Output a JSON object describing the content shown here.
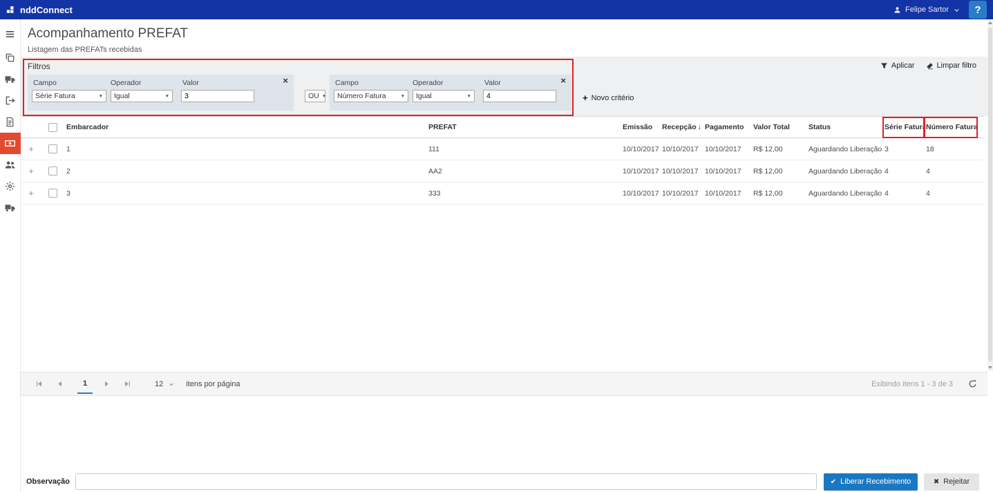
{
  "topbar": {
    "brand": "nddConnect",
    "user_name": "Felipe Sartor",
    "help_label": "?"
  },
  "page": {
    "title": "Acompanhamento PREFAT",
    "subtitle": "Listagem das PREFATs recebidas"
  },
  "filters": {
    "panel_title": "Filtros",
    "apply_label": "Aplicar",
    "clear_label": "Limpar filtro",
    "new_criterion_label": "Novo critério",
    "field_label": "Campo",
    "operator_label": "Operador",
    "value_label": "Valor",
    "connector_value": "OU",
    "criteria": [
      {
        "field": "Série Fatura",
        "operator": "Igual",
        "value": "3"
      },
      {
        "field": "Número Fatura",
        "operator": "Igual",
        "value": "4"
      }
    ]
  },
  "grid": {
    "columns": {
      "embarcador": "Embarcador",
      "prefat": "PREFAT",
      "emissao": "Emissão",
      "recepcao": "Recepção",
      "pagamento": "Pagamento",
      "valor_total": "Valor Total",
      "status": "Status",
      "serie_fatura": "Série Fatura",
      "numero_fatura": "Número Fatura"
    },
    "sorted_column": "Recepção",
    "sort_direction": "desc",
    "rows": [
      {
        "embarcador": "1",
        "prefat": "111",
        "emissao": "10/10/2017",
        "recepcao": "10/10/2017",
        "pagamento": "10/10/2017",
        "valor_total": "R$ 12,00",
        "status": "Aguardando Liberação",
        "serie_fatura": "3",
        "numero_fatura": "18"
      },
      {
        "embarcador": "2",
        "prefat": "AA2",
        "emissao": "10/10/2017",
        "recepcao": "10/10/2017",
        "pagamento": "10/10/2017",
        "valor_total": "R$ 12,00",
        "status": "Aguardando Liberação",
        "serie_fatura": "4",
        "numero_fatura": "4"
      },
      {
        "embarcador": "3",
        "prefat": "333",
        "emissao": "10/10/2017",
        "recepcao": "10/10/2017",
        "pagamento": "10/10/2017",
        "valor_total": "R$ 12,00",
        "status": "Aguardando Liberação",
        "serie_fatura": "4",
        "numero_fatura": "4"
      }
    ]
  },
  "pager": {
    "current_page": "1",
    "page_size": "12",
    "page_size_label": "itens por página",
    "info": "Exibindo itens 1 - 3 de 3"
  },
  "footer": {
    "observation_label": "Observação",
    "release_button": "Liberar Recebimento",
    "reject_button": "Rejeitar"
  },
  "icons": {
    "dropdown_arrow": "▼",
    "sort_desc": "↓",
    "plus": "+",
    "close": "×",
    "check": "✔",
    "cross": "✖"
  },
  "colors": {
    "topbar_bg": "#1334a5",
    "help_bg": "#2a7cc7",
    "active_nav_bg": "#e2492f",
    "primary_button_bg": "#1a78c2",
    "pager_accent": "#2a7cc7",
    "filter_panel_bg": "#eef0f1",
    "criterion_card_bg": "#dde4ec",
    "annotation_red": "#e41e26"
  }
}
